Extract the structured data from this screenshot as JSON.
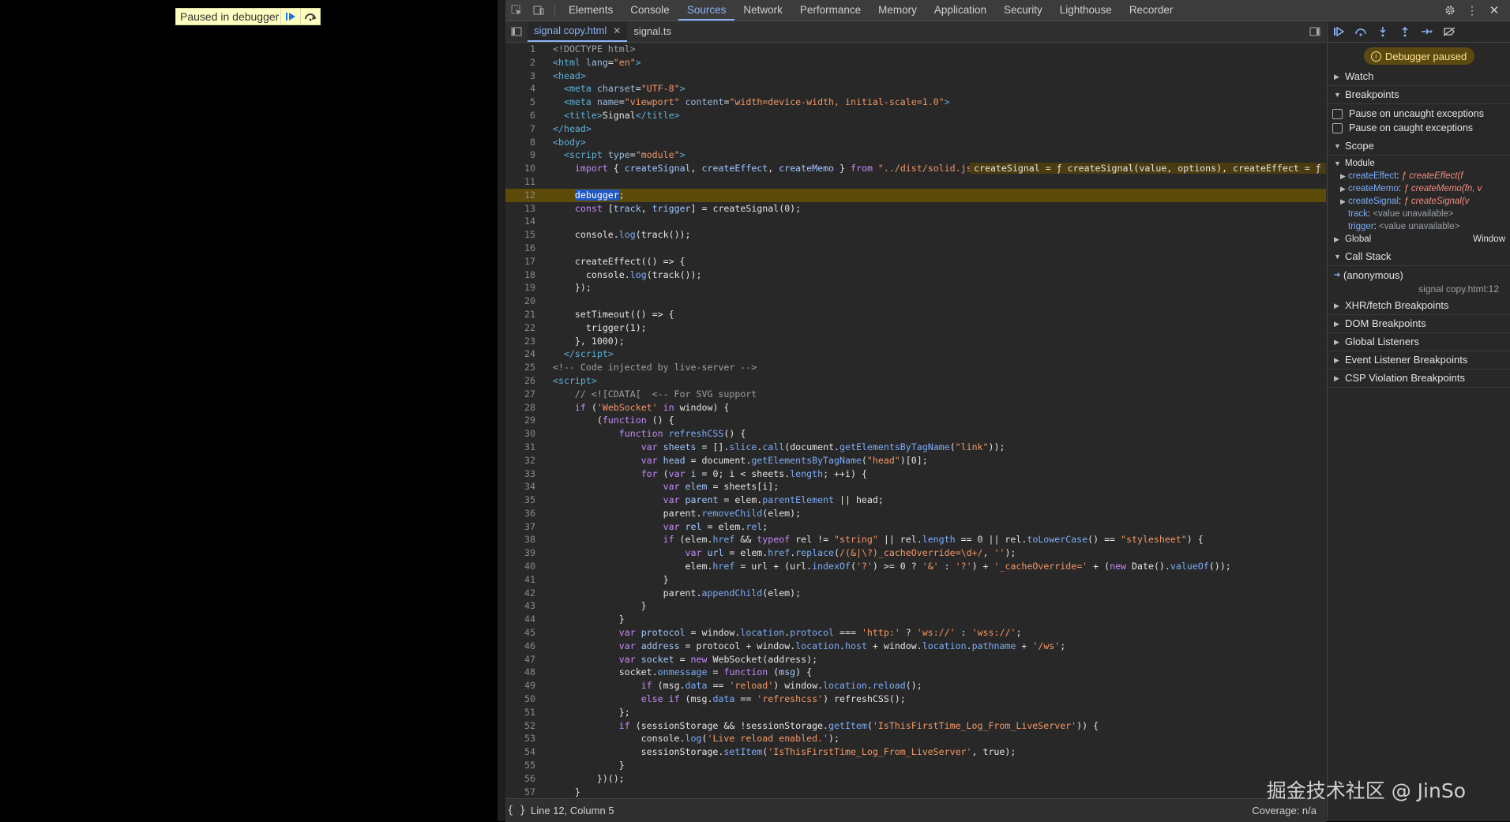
{
  "page": {
    "overlay_label": "Paused in debugger"
  },
  "devtools": {
    "tabs": [
      "Elements",
      "Console",
      "Sources",
      "Network",
      "Performance",
      "Memory",
      "Application",
      "Security",
      "Lighthouse",
      "Recorder"
    ],
    "active_tab": "Sources"
  },
  "editor": {
    "file_tabs": [
      "signal copy.html",
      "signal.ts"
    ],
    "active_file": "signal copy.html",
    "current_line": 12,
    "line_numbers": [
      1,
      2,
      3,
      4,
      5,
      6,
      7,
      8,
      9,
      10,
      11,
      12,
      13,
      14,
      15,
      16,
      17,
      18,
      19,
      20,
      21,
      22,
      23,
      24,
      25,
      26,
      27,
      28,
      29,
      30,
      31,
      32,
      33,
      34,
      35,
      36,
      37,
      38,
      39,
      40,
      41,
      42,
      43,
      44,
      45,
      46,
      47,
      48,
      49,
      50,
      51,
      52,
      53,
      54,
      55,
      56,
      57
    ],
    "inline_value_line10": "createSignal = ƒ createSignal(value, options), createEffect = ƒ crea",
    "status": {
      "position": "Line 12, Column 5",
      "coverage": "Coverage: n/a"
    }
  },
  "sidebar": {
    "paused_label": "Debugger paused",
    "watch": "Watch",
    "breakpoints": "Breakpoints",
    "pause_uncaught": "Pause on uncaught exceptions",
    "pause_caught": "Pause on caught exceptions",
    "scope": "Scope",
    "module": "Module",
    "scope_items": [
      {
        "key": "createEffect",
        "value": "ƒ createEffect(f"
      },
      {
        "key": "createMemo",
        "value": "ƒ createMemo(fn, v"
      },
      {
        "key": "createSignal",
        "value": "ƒ createSignal(v"
      },
      {
        "key": "track",
        "value": "<value unavailable>"
      },
      {
        "key": "trigger",
        "value": "<value unavailable>"
      }
    ],
    "global": "Global",
    "global_value": "Window",
    "call_stack": "Call Stack",
    "frame_name": "(anonymous)",
    "frame_location": "signal copy.html:12",
    "sections": [
      "XHR/fetch Breakpoints",
      "DOM Breakpoints",
      "Global Listeners",
      "Event Listener Breakpoints",
      "CSP Violation Breakpoints"
    ]
  },
  "watermark": "掘金技术社区 @ JinSo"
}
